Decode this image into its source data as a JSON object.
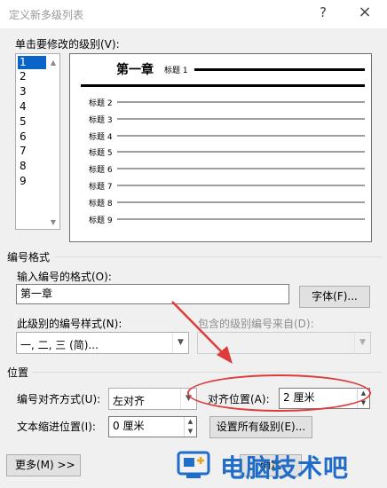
{
  "window": {
    "title": "定义新多级列表",
    "help_glyph": "?",
    "close_glyph": "×"
  },
  "level_list": {
    "label": "单击要修改的级别(V):",
    "items": [
      "1",
      "2",
      "3",
      "4",
      "5",
      "6",
      "7",
      "8",
      "9"
    ],
    "selected": "1"
  },
  "preview": {
    "chapter_heading": "第一章",
    "level1_label": "标题 1",
    "sub_levels": [
      {
        "label": "标题 2"
      },
      {
        "label": "标题 3"
      },
      {
        "label": "标题 4"
      },
      {
        "label": "标题 5"
      },
      {
        "label": "标题 6"
      },
      {
        "label": "标题 7"
      },
      {
        "label": "标题 8"
      },
      {
        "label": "标题 9"
      }
    ]
  },
  "number_format": {
    "section_label": "编号格式",
    "format_label": "输入编号的格式(O):",
    "format_value": "第一章",
    "font_button": "字体(F)...",
    "style_label": "此级别的编号样式(N):",
    "style_value": "一, 二, 三 (简)...",
    "include_label": "包含的级别编号来自(D):",
    "include_value": ""
  },
  "position": {
    "section_label": "位置",
    "alignment_label": "编号对齐方式(U):",
    "alignment_value": "左对齐",
    "align_at_label": "对齐位置(A):",
    "align_at_value": "2 厘米",
    "indent_label": "文本缩进位置(I):",
    "indent_value": "0 厘米",
    "set_all_button": "设置所有级别(E)..."
  },
  "footer": {
    "more_button": "更多(M) >>",
    "ok_button": "确定"
  },
  "watermark": {
    "text": "电脑技术吧"
  },
  "colors": {
    "selection": "#0a63c6",
    "annotation": "#dc3c3c",
    "watermark": "#1f6cc9"
  }
}
